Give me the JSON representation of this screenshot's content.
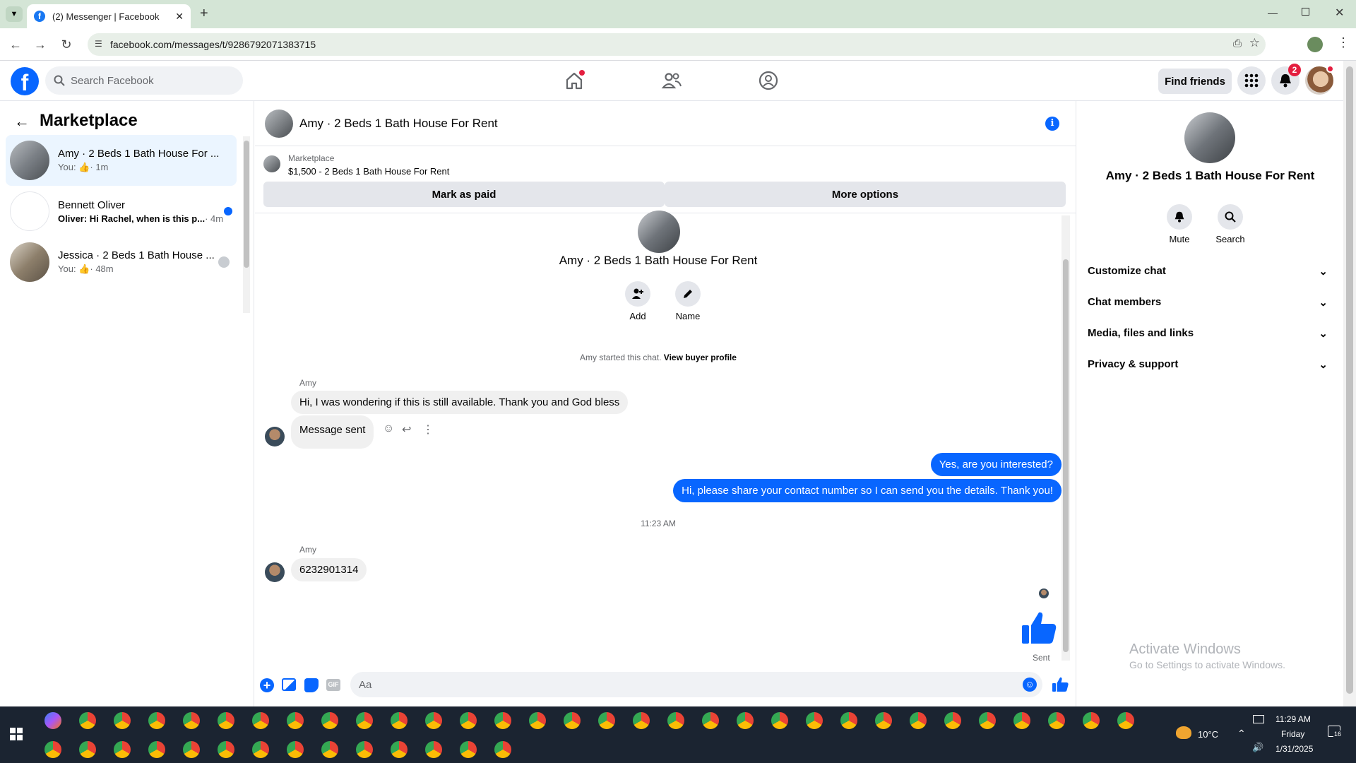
{
  "browser": {
    "tab_title": "(2) Messenger | Facebook",
    "url": "facebook.com/messages/t/9286792071383715"
  },
  "header": {
    "search_placeholder": "Search Facebook",
    "find_friends": "Find friends",
    "notification_count": "2"
  },
  "sidebar": {
    "title": "Marketplace",
    "conversations": [
      {
        "name": "Amy · 2 Beds 1 Bath House For ...",
        "preview_prefix": "You:",
        "time": "· 1m"
      },
      {
        "name": "Bennett Oliver",
        "preview": "Oliver: Hi Rachel, when is this p...",
        "time": "· 4m"
      },
      {
        "name": "Jessica · 2 Beds 1 Bath House ...",
        "preview_prefix": "You:",
        "time": "· 48m"
      }
    ]
  },
  "chat": {
    "title": "Amy · 2 Beds 1 Bath House For Rent",
    "marketplace_label": "Marketplace",
    "listing": "$1,500 - 2 Beds 1 Bath House For Rent",
    "mark_paid": "Mark as paid",
    "more_options": "More options",
    "profile_name": "Amy · 2 Beds 1 Bath House For Rent",
    "add_label": "Add",
    "name_label": "Name",
    "started_text": "Amy started this chat.",
    "buyer_profile": "View buyer profile",
    "sender_1": "Amy",
    "msg_1": "Hi, I was wondering if this is still available. Thank you and God bless",
    "msg_2": "Message sent",
    "msg_3": "Yes, are you interested?",
    "msg_4": "Hi, please share your contact number so I can send you the details. Thank you!",
    "timestamp": "11:23 AM",
    "sender_2": "Amy",
    "msg_5": "6232901314",
    "sent_label": "Sent",
    "composer_placeholder": "Aa"
  },
  "details": {
    "name": "Amy · 2 Beds 1 Bath House For Rent",
    "mute": "Mute",
    "search": "Search",
    "sections": [
      "Customize chat",
      "Chat members",
      "Media, files and links",
      "Privacy & support"
    ]
  },
  "watermark": {
    "line1": "Activate Windows",
    "line2": "Go to Settings to activate Windows."
  },
  "taskbar": {
    "temperature": "10°C",
    "time": "11:29 AM",
    "day": "Friday",
    "date": "1/31/2025",
    "notif": "16"
  },
  "colors": {
    "accent": "#0866ff",
    "tabbar": "#d4e5d6",
    "taskbar": "#1b2431"
  }
}
